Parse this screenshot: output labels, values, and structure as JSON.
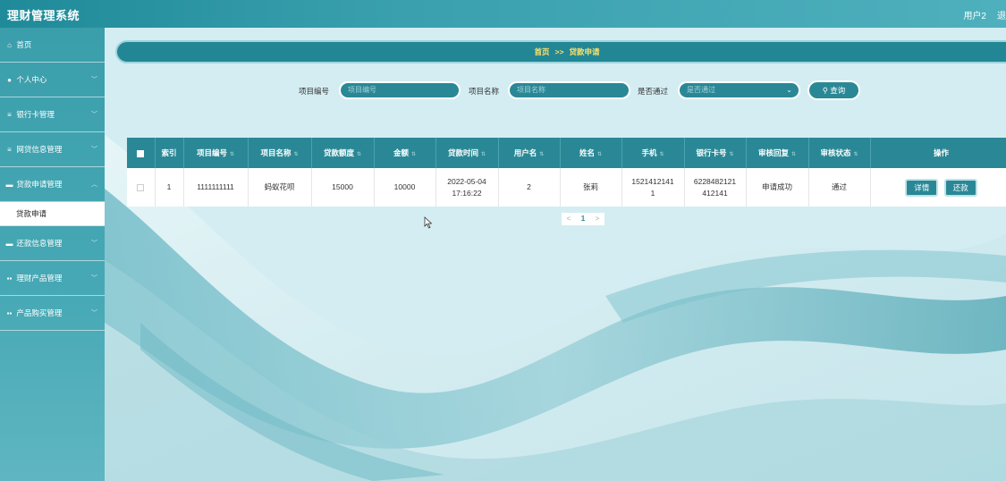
{
  "app": {
    "title": "理财管理系统"
  },
  "topbar": {
    "user": "用户2",
    "logout": "退"
  },
  "sidebar": {
    "items": [
      {
        "label": "首页",
        "icon": "home-icon",
        "glyph": "⌂"
      },
      {
        "label": "个人中心",
        "icon": "user-icon",
        "glyph": "●"
      },
      {
        "label": "银行卡管理",
        "icon": "list-icon",
        "glyph": "≡"
      },
      {
        "label": "网贷信息管理",
        "icon": "list-icon",
        "glyph": "≡"
      },
      {
        "label": "贷款申请管理",
        "icon": "comment-icon",
        "glyph": "▬"
      },
      {
        "label": "还款信息管理",
        "icon": "comment-icon",
        "glyph": "▬"
      },
      {
        "label": "理财产品管理",
        "icon": "grid-icon",
        "glyph": "▪▪"
      },
      {
        "label": "产品购买管理",
        "icon": "grid-icon",
        "glyph": "▪▪"
      }
    ],
    "submenu": {
      "label": "贷款申请"
    }
  },
  "breadcrumb": {
    "home": "首页",
    "sep": ">>",
    "current": "贷款申请"
  },
  "search": {
    "project_no_label": "项目编号",
    "project_no_placeholder": "项目编号",
    "project_name_label": "项目名称",
    "project_name_placeholder": "项目名称",
    "passed_label": "是否通过",
    "passed_placeholder": "是否通过",
    "query_button": "查询"
  },
  "table": {
    "headers": [
      "",
      "索引",
      "项目编号",
      "项目名称",
      "贷款额度",
      "金额",
      "贷款时间",
      "用户名",
      "姓名",
      "手机",
      "银行卡号",
      "审核回复",
      "审核状态",
      "操作"
    ],
    "rows": [
      {
        "index": "1",
        "project_no": "1111111111",
        "project_name": "蚂蚁花呗",
        "loan_limit": "15000",
        "amount": "10000",
        "loan_date": "2022-05-04",
        "loan_time": "17:16:22",
        "username": "2",
        "name": "张莉",
        "phone_1": "1521412141",
        "phone_2": "1",
        "card_1": "6228482121",
        "card_2": "412141",
        "review_reply": "申请成功",
        "review_status": "通过",
        "detail_button": "详情",
        "repay_button": "还款"
      }
    ]
  },
  "pager": {
    "prev": "<",
    "page": "1",
    "next": ">"
  },
  "colors": {
    "primary": "#2a8896",
    "breadcrumb_text": "#ffe36b",
    "topbar": "#1f8a99"
  }
}
